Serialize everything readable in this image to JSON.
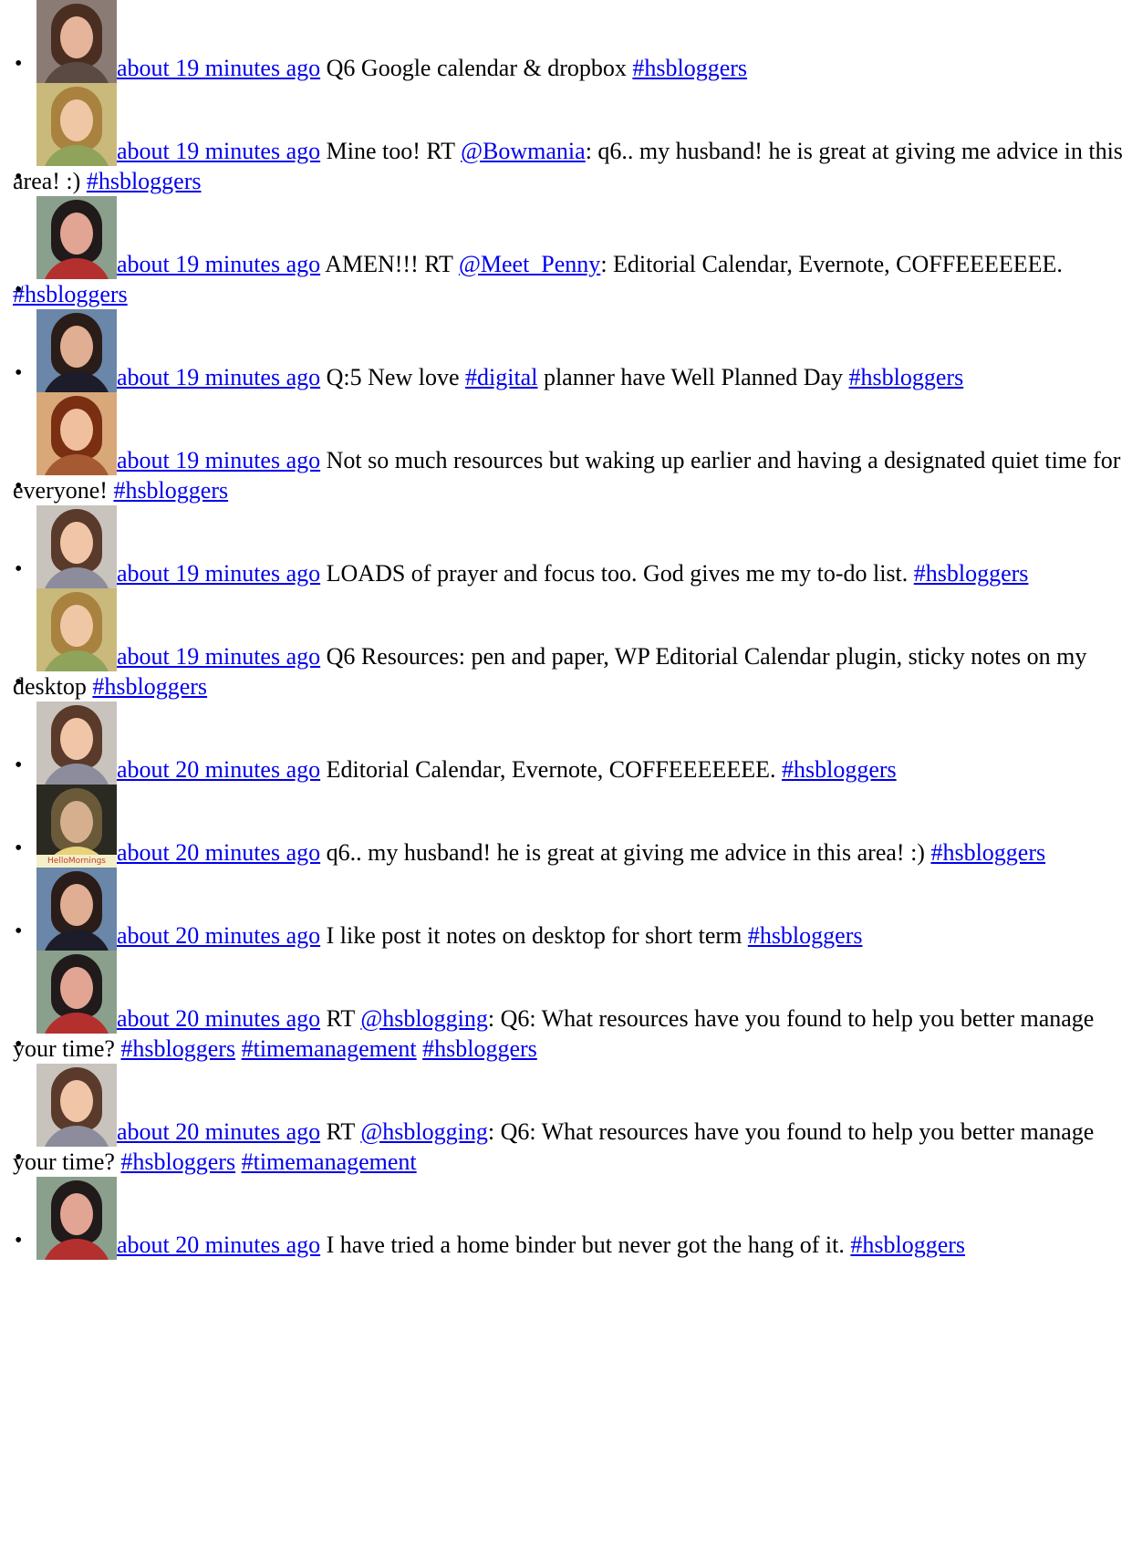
{
  "tweets": [
    {
      "avatar": "avatar-brown-hair-glasses",
      "colors": {
        "bg": "#8a7c74",
        "hair": "#4a2e22",
        "face": "#e6b49a",
        "shoulders": "#5b4a44"
      },
      "time": "about 19 minutes ago",
      "parts": [
        {
          "t": "text",
          "v": " Q6 Google calendar & dropbox "
        },
        {
          "t": "link",
          "v": "#hsbloggers"
        }
      ]
    },
    {
      "avatar": "avatar-blonde-smiling",
      "colors": {
        "bg": "#c9b97a",
        "hair": "#a8823e",
        "face": "#efc7a5",
        "shoulders": "#8fa35a"
      },
      "time": "about 19 minutes ago",
      "parts": [
        {
          "t": "text",
          "v": " Mine too! RT "
        },
        {
          "t": "link",
          "v": "@Bowmania"
        },
        {
          "t": "text",
          "v": ": q6.. my husband! he is great at giving me advice in this area! :) "
        },
        {
          "t": "link",
          "v": "#hsbloggers"
        }
      ]
    },
    {
      "avatar": "avatar-dark-hair-closeup",
      "colors": {
        "bg": "#8a9f8c",
        "hair": "#201a1a",
        "face": "#e2a493",
        "shoulders": "#b4302e"
      },
      "time": "about 19 minutes ago",
      "parts": [
        {
          "t": "text",
          "v": " AMEN!!! RT "
        },
        {
          "t": "link",
          "v": "@Meet_Penny"
        },
        {
          "t": "text",
          "v": ": Editorial Calendar, Evernote, COFFEEEEEEE. "
        },
        {
          "t": "link",
          "v": "#hsbloggers"
        }
      ]
    },
    {
      "avatar": "avatar-dark-hair-professional",
      "colors": {
        "bg": "#6a86a8",
        "hair": "#2a1c18",
        "face": "#dfae93",
        "shoulders": "#1c1c2a"
      },
      "time": "about 19 minutes ago",
      "parts": [
        {
          "t": "text",
          "v": " Q:5 New love "
        },
        {
          "t": "link",
          "v": "#digital"
        },
        {
          "t": "text",
          "v": " planner have Well Planned Day "
        },
        {
          "t": "link",
          "v": "#hsbloggers"
        }
      ]
    },
    {
      "avatar": "avatar-red-hair",
      "colors": {
        "bg": "#d9a879",
        "hair": "#7a2e12",
        "face": "#f0c09e",
        "shoulders": "#a65a32"
      },
      "time": "about 19 minutes ago",
      "parts": [
        {
          "t": "text",
          "v": " Not so much resources but waking up earlier and having a designated quiet time for everyone! "
        },
        {
          "t": "link",
          "v": "#hsbloggers"
        }
      ]
    },
    {
      "avatar": "avatar-brunette-smiling",
      "colors": {
        "bg": "#c9c3bd",
        "hair": "#5a3a2a",
        "face": "#f1c6a8",
        "shoulders": "#8c8c9c"
      },
      "time": "about 19 minutes ago",
      "parts": [
        {
          "t": "text",
          "v": " LOADS of prayer and focus too. God gives me my to-do list. "
        },
        {
          "t": "link",
          "v": "#hsbloggers"
        }
      ]
    },
    {
      "avatar": "avatar-blonde-smiling",
      "colors": {
        "bg": "#c9b97a",
        "hair": "#a8823e",
        "face": "#efc7a5",
        "shoulders": "#8fa35a"
      },
      "time": "about 19 minutes ago",
      "parts": [
        {
          "t": "text",
          "v": " Q6 Resources: pen and paper, WP Editorial Calendar plugin, sticky notes on my desktop "
        },
        {
          "t": "link",
          "v": "#hsbloggers"
        }
      ]
    },
    {
      "avatar": "avatar-brunette-smiling",
      "colors": {
        "bg": "#c9c3bd",
        "hair": "#5a3a2a",
        "face": "#f1c6a8",
        "shoulders": "#8c8c9c"
      },
      "time": "about 20 minutes ago",
      "parts": [
        {
          "t": "text",
          "v": " Editorial Calendar, Evernote, COFFEEEEEEE. "
        },
        {
          "t": "link",
          "v": "#hsbloggers"
        }
      ]
    },
    {
      "avatar": "avatar-hello-mornings",
      "colors": {
        "bg": "#2a2a22",
        "hair": "#6a5a3a",
        "face": "#d6b08e",
        "shoulders": "#e8d27a"
      },
      "small_logo": "HelloMornings",
      "time": "about 20 minutes ago",
      "parts": [
        {
          "t": "text",
          "v": " q6.. my husband! he is great at giving me advice in this area! :) "
        },
        {
          "t": "link",
          "v": "#hsbloggers"
        }
      ]
    },
    {
      "avatar": "avatar-dark-hair-professional",
      "colors": {
        "bg": "#6a86a8",
        "hair": "#2a1c18",
        "face": "#dfae93",
        "shoulders": "#1c1c2a"
      },
      "time": "about 20 minutes ago",
      "parts": [
        {
          "t": "text",
          "v": " I like post it notes on desktop for short term "
        },
        {
          "t": "link",
          "v": "#hsbloggers"
        }
      ]
    },
    {
      "avatar": "avatar-dark-hair-closeup",
      "colors": {
        "bg": "#8a9f8c",
        "hair": "#201a1a",
        "face": "#e2a493",
        "shoulders": "#b4302e"
      },
      "time": "about 20 minutes ago",
      "parts": [
        {
          "t": "text",
          "v": " RT "
        },
        {
          "t": "link",
          "v": "@hsblogging"
        },
        {
          "t": "text",
          "v": ": Q6: What resources have you found to help you better manage your time? "
        },
        {
          "t": "link",
          "v": "#hsbloggers"
        },
        {
          "t": "text",
          "v": " "
        },
        {
          "t": "link",
          "v": "#timemanagement"
        },
        {
          "t": "text",
          "v": " "
        },
        {
          "t": "link",
          "v": "#hsbloggers"
        }
      ]
    },
    {
      "avatar": "avatar-brunette-smiling",
      "colors": {
        "bg": "#c9c3bd",
        "hair": "#5a3a2a",
        "face": "#f1c6a8",
        "shoulders": "#8c8c9c"
      },
      "time": "about 20 minutes ago",
      "parts": [
        {
          "t": "text",
          "v": " RT "
        },
        {
          "t": "link",
          "v": "@hsblogging"
        },
        {
          "t": "text",
          "v": ": Q6: What resources have you found to help you better manage your time? "
        },
        {
          "t": "link",
          "v": "#hsbloggers"
        },
        {
          "t": "text",
          "v": " "
        },
        {
          "t": "link",
          "v": "#timemanagement"
        }
      ]
    },
    {
      "avatar": "avatar-dark-hair-closeup",
      "colors": {
        "bg": "#8a9f8c",
        "hair": "#201a1a",
        "face": "#e2a493",
        "shoulders": "#b4302e"
      },
      "time": "about 20 minutes ago",
      "parts": [
        {
          "t": "text",
          "v": " I have tried a home binder but never got the hang of it. "
        },
        {
          "t": "link",
          "v": "#hsbloggers"
        }
      ]
    }
  ],
  "link_color": "#0000ee",
  "text_color": "#000000"
}
